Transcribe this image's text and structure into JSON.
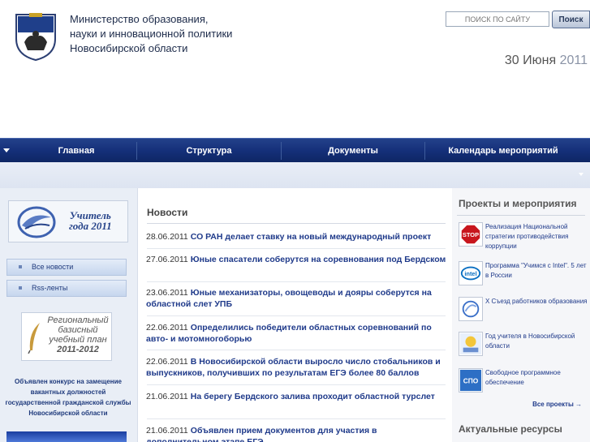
{
  "header": {
    "ministry_line1": "Министерство образования,",
    "ministry_line2": "науки и инновационной политики",
    "ministry_line3": "Новосибирской области",
    "search_placeholder": "ПОИСК ПО САЙТУ",
    "search_button": "Поиск",
    "date_day_month": "30 Июня",
    "date_year": "2011"
  },
  "nav": {
    "items": [
      "Главная",
      "Структура",
      "Документы",
      "Календарь мероприятий"
    ]
  },
  "left": {
    "teacher_banner_line1": "Учитель",
    "teacher_banner_line2": "года 2011",
    "links": [
      "Все новости",
      "Rss-ленты"
    ],
    "plan_banner_line1": "Региональный",
    "plan_banner_line2": "базисный",
    "plan_banner_line3": "учебный план",
    "plan_banner_line4": "2011-2012",
    "contest_text": "Объявлен конкурс на замещение вакантных должностей государственной гражданской службы Новосибирской области"
  },
  "news": {
    "title": "Новости",
    "items": [
      {
        "date": "28.06.2011",
        "title": "СО РАН делает ставку на новый международный проект"
      },
      {
        "date": "27.06.2011",
        "title": "Юные спасатели соберутся на соревнования под Бердском"
      },
      {
        "date": "23.06.2011",
        "title": "Юные механизаторы, овощеводы и дояры соберутся на областной слет УПБ"
      },
      {
        "date": "22.06.2011",
        "title": "Определились победители областных соревнований по авто- и мотомногоборью"
      },
      {
        "date": "22.06.2011",
        "title": "В Новосибирской области выросло число стобальников и выпускников, получивших по результатам ЕГЭ более 80 баллов"
      },
      {
        "date": "21.06.2011",
        "title": "На берегу Бердского залива проходит областной турслет"
      },
      {
        "date": "21.06.2011",
        "title": "Объявлен прием документов для участия в дополнительном этапе ЕГЭ"
      }
    ]
  },
  "projects": {
    "title": "Проекты и мероприятия",
    "items": [
      {
        "text": "Реализация Национальной стратегии противодействия коррупции",
        "icon": "stop-corruption-icon"
      },
      {
        "text": "Программа \"Учимся с Intel\". 5 лет в России",
        "icon": "intel-icon"
      },
      {
        "text": "X Съезд работников образования",
        "icon": "congress-icon"
      },
      {
        "text": "Год учителя в Новосибирской области",
        "icon": "teacher-year-icon"
      },
      {
        "text": "Свободное программное обеспечение",
        "icon": "spo-icon"
      }
    ],
    "all_link": "Все проекты →",
    "resources_title": "Актуальные ресурсы"
  }
}
